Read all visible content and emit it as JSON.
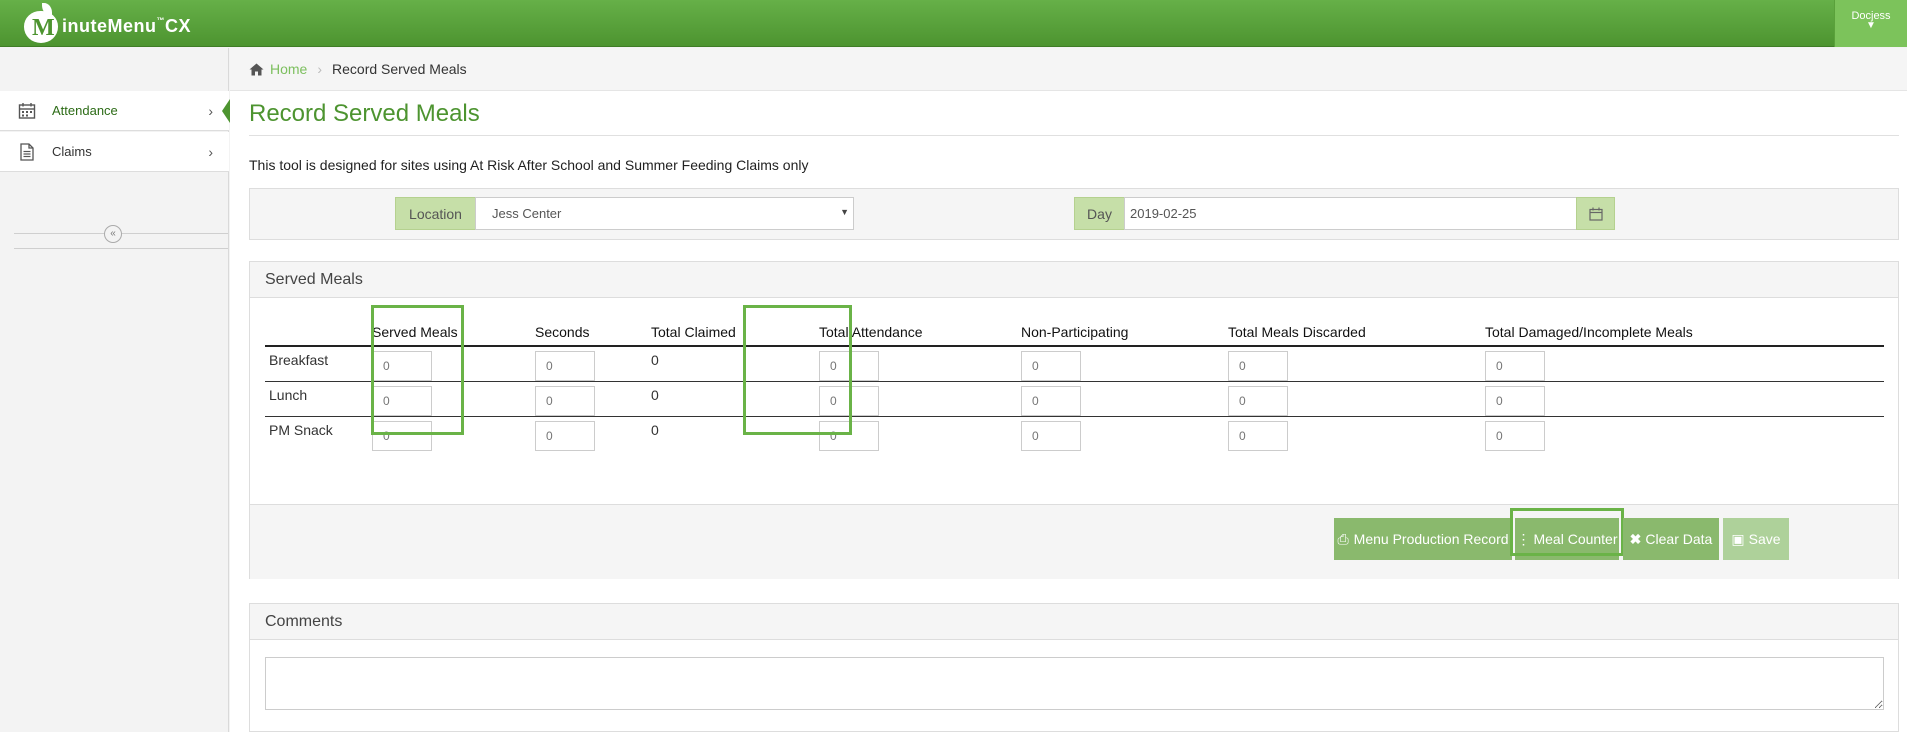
{
  "app": {
    "brand_initial": "M",
    "brand_rest": "inuteMenu",
    "brand_tm": "™",
    "brand_suffix": "CX",
    "user": "Docjess"
  },
  "sidebar": {
    "items": [
      {
        "label": "Attendance",
        "icon": "calendar-icon",
        "active": true
      },
      {
        "label": "Claims",
        "icon": "document-icon",
        "active": false
      }
    ],
    "collapse_glyph": "«"
  },
  "breadcrumb": {
    "home": "Home",
    "current": "Record Served Meals"
  },
  "page": {
    "title": "Record Served Meals",
    "intro": "This tool is designed for sites using At Risk After School and Summer Feeding Claims only"
  },
  "filters": {
    "location_label": "Location",
    "location_value": "Jess Center",
    "day_label": "Day",
    "day_value": "2019-02-25"
  },
  "served_meals": {
    "heading": "Served Meals",
    "columns": [
      "",
      "Served Meals",
      "Seconds",
      "Total Claimed",
      "Total Attendance",
      "Non-Participating",
      "Total Meals Discarded",
      "Total Damaged/Incomplete Meals"
    ],
    "rows": [
      {
        "meal": "Breakfast",
        "served": "0",
        "seconds": "0",
        "claimed": "0",
        "attendance": "0",
        "nonpart": "0",
        "discarded": "0",
        "damaged": "0"
      },
      {
        "meal": "Lunch",
        "served": "0",
        "seconds": "0",
        "claimed": "0",
        "attendance": "0",
        "nonpart": "0",
        "discarded": "0",
        "damaged": "0"
      },
      {
        "meal": "PM Snack",
        "served": "0",
        "seconds": "0",
        "claimed": "0",
        "attendance": "0",
        "nonpart": "0",
        "discarded": "0",
        "damaged": "0"
      }
    ],
    "input_placeholder": "0",
    "buttons": {
      "menu_production": "Menu Production Record",
      "meal_counter": "Meal Counter",
      "clear": "Clear Data",
      "save": "Save"
    }
  },
  "comments": {
    "heading": "Comments"
  },
  "colors": {
    "brand_green": "#4d9430",
    "highlight": "#6ab347",
    "button_green": "#8ab96d"
  }
}
